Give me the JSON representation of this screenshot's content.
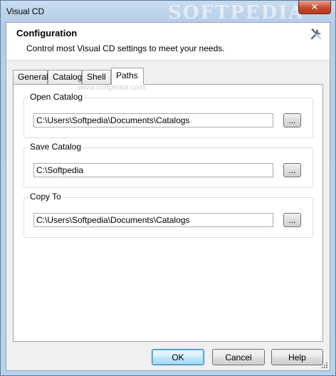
{
  "window": {
    "title": "Visual CD",
    "watermark": "SOFTPEDIA",
    "close_label": "✕"
  },
  "header": {
    "title": "Configuration",
    "subtitle": "Control most Visual CD settings to meet your needs.",
    "icon": "tools-icon"
  },
  "tabs": [
    {
      "label": "General",
      "active": false
    },
    {
      "label": "Catalog",
      "active": false
    },
    {
      "label": "Shell",
      "active": false
    },
    {
      "label": "Paths",
      "active": true
    }
  ],
  "panel": {
    "watermark": "www.softpedia.com"
  },
  "groups": [
    {
      "label": "Open Catalog",
      "value": "C:\\Users\\Softpedia\\Documents\\Catalogs",
      "browse_label": "..."
    },
    {
      "label": "Save Catalog",
      "value": "C:\\Softpedia",
      "browse_label": "..."
    },
    {
      "label": "Copy To",
      "value": "C:\\Users\\Softpedia\\Documents\\Catalogs",
      "browse_label": "..."
    }
  ],
  "footer": {
    "ok_label": "OK",
    "cancel_label": "Cancel",
    "help_label": "Help"
  },
  "colors": {
    "frame": "#b9d1ea",
    "close_button": "#c7482a",
    "default_button_border": "#3c7fb1"
  }
}
